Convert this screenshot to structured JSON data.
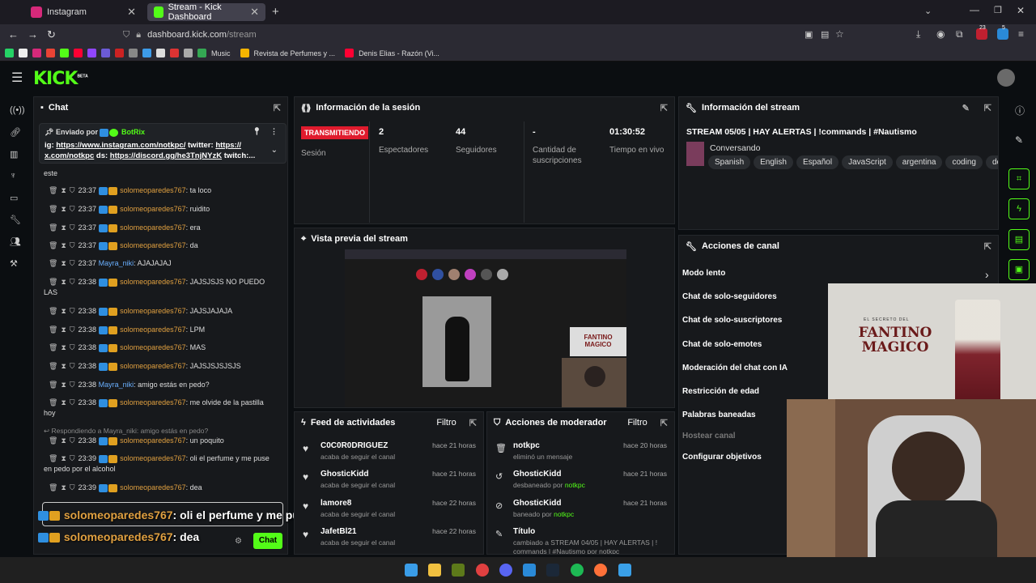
{
  "browser": {
    "tabs": [
      {
        "title": "Instagram",
        "close": "✕"
      },
      {
        "title": "Stream - Kick Dashboard",
        "close": "✕"
      }
    ],
    "new_tab": "+",
    "url_domain": "dashboard.kick.com",
    "url_path": "/stream",
    "bookmarks": [
      "Music",
      "Revista de Perfumes y ...",
      "Denis Elias - Razón (Vi..."
    ],
    "ext_badge_1": "23",
    "ext_badge_2": "5"
  },
  "kick": {
    "logo": "KICK",
    "logo_beta": "BETA"
  },
  "chat": {
    "title": "Chat",
    "pinned_by_label": "Enviado por",
    "pinned_user": "BotRix",
    "pinned_text_1": "ig: ",
    "pinned_link_1": "https://www.instagram.com/notkpc/",
    "pinned_text_2": " twitter: ",
    "pinned_link_2": "https://",
    "pinned_link_3": "x.com/notkpc",
    "pinned_text_3": " ds: ",
    "pinned_link_4": "https://discord.gg/he3TnjNYzK",
    "pinned_text_4": " twitch:...",
    "partial_top": "este",
    "messages": [
      {
        "time": "23:37",
        "user": "solomeoparedes767",
        "text": ": ta loco"
      },
      {
        "time": "23:37",
        "user": "solomeoparedes767",
        "text": ": ruidito"
      },
      {
        "time": "23:37",
        "user": "solomeoparedes767",
        "text": ": era"
      },
      {
        "time": "23:37",
        "user": "solomeoparedes767",
        "text": ": da"
      },
      {
        "time": "23:37",
        "user": "Mayra_niki",
        "text": ": AJAJAJAJ"
      },
      {
        "time": "23:38",
        "user": "solomeoparedes767",
        "text": ": JAJSJSJS NO PUEDO",
        "cont": "LAS"
      },
      {
        "time": "23:38",
        "user": "solomeoparedes767",
        "text": ": JAJSJAJAJA"
      },
      {
        "time": "23:38",
        "user": "solomeoparedes767",
        "text": ": LPM"
      },
      {
        "time": "23:38",
        "user": "solomeoparedes767",
        "text": ": MAS"
      },
      {
        "time": "23:38",
        "user": "solomeoparedes767",
        "text": ": JAJSJSJSJSJS"
      },
      {
        "time": "23:38",
        "user": "Mayra_niki",
        "text": ": amigo estás en pedo?"
      },
      {
        "time": "23:38",
        "user": "solomeoparedes767",
        "text": ": me olvide de la pastilla",
        "cont": "hoy"
      },
      {
        "time": "23:38",
        "user": "solomeoparedes767",
        "text": ": un poquito"
      },
      {
        "time": "23:39",
        "user": "solomeoparedes767",
        "text": ": oli el perfume y me puse",
        "cont": "en pedo por el alcohol"
      },
      {
        "time": "23:39",
        "user": "solomeoparedes767",
        "text": ": dea"
      }
    ],
    "reply_label": "Respondiendo a Mayra_niki: amigo estás en pedo?",
    "send_button": "Chat"
  },
  "captions": {
    "line1_user": "solomeoparedes767",
    "line1_text": ": oli el perfume y me puse en pedo por el alcohol",
    "line2_user": "solomeoparedes767",
    "line2_text": ": dea"
  },
  "session": {
    "title": "Información de la sesión",
    "live_badge": "TRANSMITIENDO",
    "session_label": "Sesión",
    "viewers_value": "2",
    "viewers_label": "Espectadores",
    "followers_value": "44",
    "followers_label": "Seguidores",
    "subs_value": "-",
    "subs_label_1": "Cantidad de",
    "subs_label_2": "suscripciones",
    "uptime_value": "01:30:52",
    "uptime_label": "Tiempo en vivo"
  },
  "stream_info": {
    "title": "Información del stream",
    "stream_title": "STREAM 05/05 | HAY ALERTAS | !commands | #Nautismo",
    "category": "Conversando",
    "tags": [
      "Spanish",
      "English",
      "Español",
      "JavaScript",
      "argentina",
      "coding",
      "devel"
    ]
  },
  "preview": {
    "title": "Vista previa del stream",
    "overlay_line1": "FANTINO",
    "overlay_line2": "MAGICO"
  },
  "channel_actions": {
    "title": "Acciones de canal",
    "items": [
      "Modo lento",
      "Chat de solo-seguidores",
      "Chat de solo-suscriptores",
      "Chat de solo-emotes",
      "Moderación del chat con IA",
      "Restricción de edad",
      "Palabras baneadas",
      "Hostear canal",
      "Configurar objetivos"
    ]
  },
  "activity": {
    "title": "Feed de actividades",
    "filter": "Filtro",
    "items": [
      {
        "name": "C0C0R0DRIGUEZ",
        "sub": "acaba de seguir el canal",
        "time": "hace 21 horas"
      },
      {
        "name": "GhosticKidd",
        "sub": "acaba de seguir el canal",
        "time": "hace 21 horas"
      },
      {
        "name": "lamore8",
        "sub": "acaba de seguir el canal",
        "time": "hace 22 horas"
      },
      {
        "name": "JafetBl21",
        "sub": "acaba de seguir el canal",
        "time": "hace 22 horas"
      }
    ]
  },
  "mod_actions": {
    "title": "Acciones de moderador",
    "filter": "Filtro",
    "items": [
      {
        "name": "notkpc",
        "sub": "eliminó un mensaje",
        "by": "",
        "time": "hace 20 horas"
      },
      {
        "name": "GhosticKidd",
        "sub": "desbaneado por ",
        "by": "notkpc",
        "time": "hace 21 horas"
      },
      {
        "name": "GhosticKidd",
        "sub": "baneado por ",
        "by": "notkpc",
        "time": "hace 21 horas"
      },
      {
        "name": "Título",
        "sub": "cambiado a STREAM 04/05 | HAY ALERTAS | !",
        "by": "",
        "time": ""
      }
    ],
    "title_sub2": "commands | #Nautismo por notkpc"
  },
  "webcam_poster": {
    "small_text": "EL SECRETO DEL",
    "line1": "FANTINO",
    "line2": "MAGICO"
  },
  "colors": {
    "kick_green": "#53fc18",
    "live_red": "#e01b2d",
    "panel_bg": "#17191c"
  }
}
